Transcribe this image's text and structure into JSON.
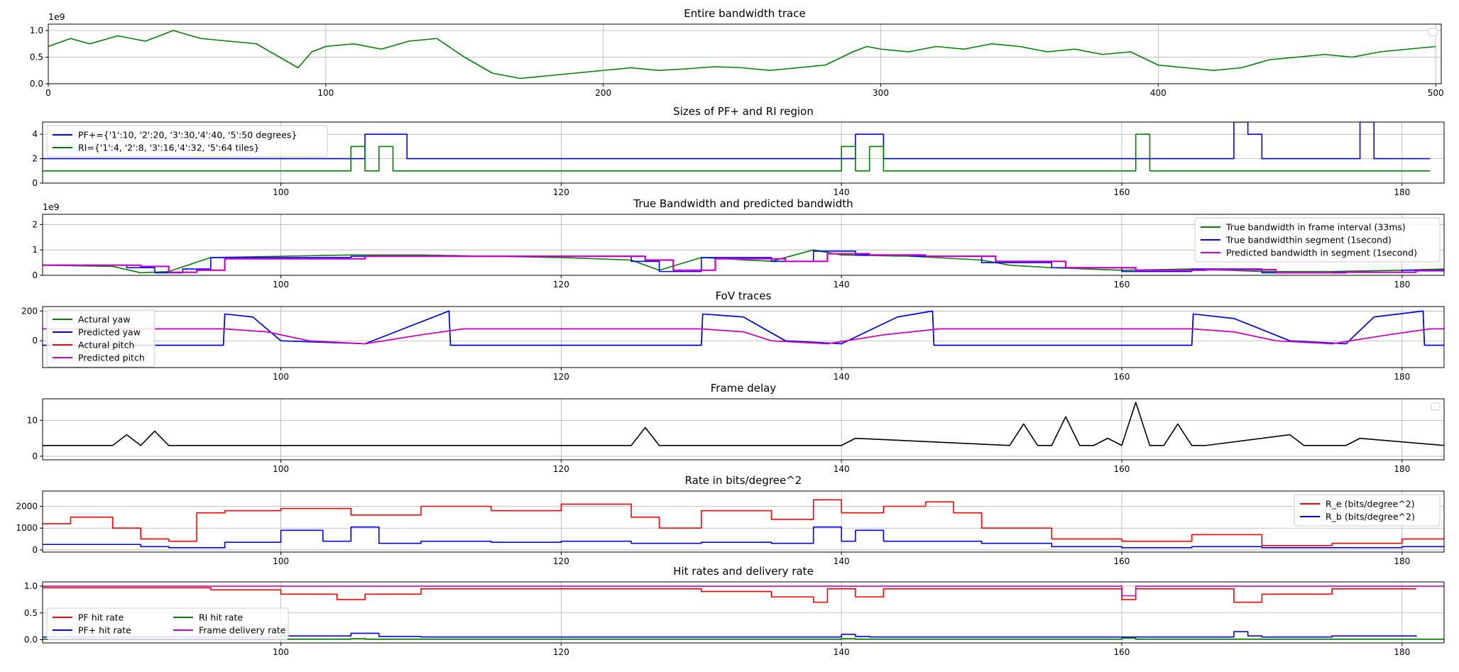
{
  "chart_data": [
    {
      "type": "line",
      "title": "Entire bandwidth trace",
      "xlim": [
        0,
        502
      ],
      "ylim": [
        0,
        1.12
      ],
      "y_exponent": "1e9",
      "xticks": [
        0,
        100,
        200,
        300,
        400,
        500
      ],
      "yticks": [
        0.0,
        0.5,
        1.0
      ],
      "ytick_labels": [
        "0.0",
        "0.5",
        "1.0"
      ],
      "grid": true,
      "legend": "top-right (empty)",
      "series": [
        {
          "color": "#008000",
          "x": [
            0,
            8,
            15,
            25,
            35,
            45,
            55,
            65,
            75,
            85,
            90,
            95,
            100,
            110,
            120,
            130,
            140,
            150,
            160,
            170,
            180,
            190,
            200,
            210,
            220,
            230,
            240,
            250,
            260,
            270,
            280,
            290,
            295,
            300,
            310,
            320,
            330,
            340,
            350,
            360,
            370,
            380,
            390,
            400,
            410,
            420,
            430,
            440,
            450,
            460,
            470,
            480,
            490,
            500
          ],
          "y": [
            0.7,
            0.85,
            0.75,
            0.9,
            0.8,
            1.0,
            0.85,
            0.8,
            0.75,
            0.45,
            0.3,
            0.6,
            0.7,
            0.75,
            0.65,
            0.8,
            0.85,
            0.5,
            0.2,
            0.1,
            0.15,
            0.2,
            0.25,
            0.3,
            0.25,
            0.28,
            0.32,
            0.3,
            0.25,
            0.3,
            0.35,
            0.6,
            0.7,
            0.65,
            0.6,
            0.7,
            0.65,
            0.75,
            0.7,
            0.6,
            0.65,
            0.55,
            0.6,
            0.35,
            0.3,
            0.25,
            0.3,
            0.45,
            0.5,
            0.55,
            0.5,
            0.6,
            0.65,
            0.7
          ]
        }
      ]
    },
    {
      "type": "line",
      "title": "Sizes of PF+ and RI region",
      "xlim": [
        83,
        183
      ],
      "ylim": [
        0,
        5
      ],
      "xticks": [
        100,
        120,
        140,
        160,
        180
      ],
      "yticks": [
        0,
        2,
        4
      ],
      "ytick_labels": [
        "0",
        "2",
        "4"
      ],
      "grid": true,
      "legend": "upper-left",
      "series": [
        {
          "name": "PF+={'1':10, '2':20, '3':30,'4':40, '5':50 degrees}",
          "color": "#0000ff",
          "step": true,
          "x": [
            83,
            106,
            109,
            141,
            143,
            168,
            169,
            170,
            177,
            178,
            182
          ],
          "y": [
            2,
            4,
            2,
            4,
            2,
            5,
            4,
            2,
            5,
            2,
            2
          ]
        },
        {
          "name": "RI={'1':4, '2':8, '3':16,'4':32, '5':64 tiles}",
          "color": "#008000",
          "step": true,
          "x": [
            83,
            105,
            106,
            107,
            108,
            140,
            141,
            142,
            143,
            161,
            162,
            182
          ],
          "y": [
            1,
            3,
            1,
            3,
            1,
            3,
            1,
            3,
            1,
            4,
            1,
            1
          ]
        }
      ]
    },
    {
      "type": "line",
      "title": "True Bandwidth and predicted bandwidth",
      "xlim": [
        83,
        183
      ],
      "ylim": [
        0,
        2.4
      ],
      "y_exponent": "1e9",
      "xticks": [
        100,
        120,
        140,
        160,
        180
      ],
      "yticks": [
        0,
        1,
        2
      ],
      "ytick_labels": [
        "0",
        "1",
        "2"
      ],
      "grid": true,
      "legend": "upper-right",
      "series": [
        {
          "name": "True bandwidth in frame interval (33ms)",
          "color": "#008000",
          "x": [
            83,
            88,
            90,
            92,
            95,
            100,
            105,
            110,
            115,
            120,
            125,
            127,
            130,
            135,
            138,
            140,
            145,
            150,
            152,
            155,
            160,
            165,
            170,
            175,
            180,
            183
          ],
          "y": [
            0.4,
            0.35,
            0.1,
            0.15,
            0.7,
            0.75,
            0.8,
            0.8,
            0.75,
            0.7,
            0.6,
            0.2,
            0.7,
            0.55,
            1.0,
            0.8,
            0.75,
            0.6,
            0.4,
            0.3,
            0.2,
            0.25,
            0.15,
            0.15,
            0.2,
            0.25
          ]
        },
        {
          "name": "True bandwidthin segment (1second)",
          "color": "#0000ff",
          "step": true,
          "x": [
            83,
            89,
            91,
            93,
            95,
            105,
            115,
            125,
            127,
            130,
            135,
            138,
            141,
            145,
            150,
            155,
            160,
            165,
            170,
            175,
            180,
            183
          ],
          "y": [
            0.4,
            0.3,
            0.1,
            0.25,
            0.7,
            0.75,
            0.75,
            0.55,
            0.15,
            0.7,
            0.55,
            0.95,
            0.8,
            0.75,
            0.5,
            0.3,
            0.15,
            0.25,
            0.1,
            0.12,
            0.2,
            0.2
          ]
        },
        {
          "name": "Predicted bandwidth in segment (1second)",
          "color": "#cc00cc",
          "step": true,
          "x": [
            83,
            90,
            92,
            94,
            96,
            106,
            116,
            126,
            128,
            131,
            136,
            139,
            142,
            146,
            151,
            156,
            161,
            166,
            171,
            176,
            181,
            183
          ],
          "y": [
            0.4,
            0.35,
            0.12,
            0.2,
            0.65,
            0.75,
            0.75,
            0.6,
            0.2,
            0.65,
            0.55,
            0.85,
            0.8,
            0.75,
            0.55,
            0.3,
            0.2,
            0.22,
            0.1,
            0.12,
            0.18,
            0.2
          ]
        }
      ]
    },
    {
      "type": "line",
      "title": "FoV traces",
      "xlim": [
        83,
        183
      ],
      "ylim": [
        -180,
        230
      ],
      "xticks": [
        100,
        120,
        140,
        160,
        180
      ],
      "yticks": [
        0,
        200
      ],
      "ytick_labels": [
        "0",
        "200"
      ],
      "grid": true,
      "legend": "upper-left",
      "series": [
        {
          "name": "Actural yaw",
          "color": "#008000",
          "x": [
            83,
            95.9,
            96,
            98,
            100,
            106,
            112,
            112.1,
            130,
            130.1,
            133,
            136,
            140,
            144,
            146.5,
            146.6,
            165,
            165.1,
            168,
            172,
            176,
            178,
            181.5,
            181.6,
            183
          ],
          "y": [
            -30,
            -30,
            180,
            160,
            0,
            -20,
            200,
            -30,
            -30,
            180,
            160,
            0,
            -20,
            160,
            200,
            -30,
            -30,
            180,
            150,
            0,
            -20,
            160,
            200,
            -30,
            -30
          ]
        },
        {
          "name": "Predicted yaw",
          "color": "#0000ff",
          "x": [
            83,
            95.9,
            96,
            98,
            100,
            106,
            112,
            112.1,
            130,
            130.1,
            133,
            136,
            140,
            144,
            146.5,
            146.6,
            165,
            165.1,
            168,
            172,
            176,
            178,
            181.5,
            181.6,
            183
          ],
          "y": [
            -30,
            -30,
            180,
            160,
            0,
            -20,
            200,
            -30,
            -30,
            180,
            160,
            0,
            -20,
            160,
            200,
            -30,
            -30,
            180,
            150,
            0,
            -20,
            160,
            200,
            -30,
            -30
          ]
        },
        {
          "name": "Actural pitch",
          "color": "#ff0000",
          "x": [
            83,
            96,
            99,
            102,
            106,
            110,
            113,
            130,
            133,
            135,
            139,
            143,
            147,
            165,
            168,
            171,
            175,
            179,
            182,
            183
          ],
          "y": [
            80,
            80,
            60,
            0,
            -20,
            40,
            80,
            80,
            60,
            0,
            -20,
            40,
            80,
            80,
            60,
            0,
            -20,
            40,
            80,
            80
          ]
        },
        {
          "name": "Predicted pitch",
          "color": "#cc00cc",
          "x": [
            83,
            96,
            99,
            102,
            106,
            110,
            113,
            130,
            133,
            135,
            139,
            143,
            147,
            165,
            168,
            171,
            175,
            179,
            182,
            183
          ],
          "y": [
            80,
            80,
            60,
            0,
            -20,
            40,
            80,
            80,
            60,
            0,
            -20,
            40,
            80,
            80,
            60,
            0,
            -20,
            40,
            80,
            80
          ]
        }
      ]
    },
    {
      "type": "line",
      "title": "Frame delay",
      "xlim": [
        83,
        183
      ],
      "ylim": [
        -1,
        16
      ],
      "xticks": [
        100,
        120,
        140,
        160,
        180
      ],
      "yticks": [
        0,
        10
      ],
      "ytick_labels": [
        "0",
        "10"
      ],
      "grid": true,
      "legend": "top-right (empty)",
      "series": [
        {
          "color": "#000000",
          "x": [
            83,
            88,
            89,
            90,
            91,
            92,
            93,
            125,
            126,
            127,
            128,
            140,
            141,
            152,
            153,
            154,
            155,
            156,
            157,
            158,
            159,
            160,
            161,
            162,
            163,
            164,
            165,
            166,
            172,
            173,
            176,
            177,
            183
          ],
          "y": [
            3,
            3,
            6,
            3,
            7,
            3,
            3,
            3,
            8,
            3,
            3,
            3,
            5,
            3,
            9,
            3,
            3,
            11,
            3,
            3,
            5,
            3,
            15,
            3,
            3,
            9,
            3,
            3,
            6,
            3,
            3,
            5,
            3
          ]
        }
      ]
    },
    {
      "type": "line",
      "title": "Rate in bits/degree^2",
      "xlim": [
        83,
        183
      ],
      "ylim": [
        -100,
        2700
      ],
      "xticks": [
        100,
        120,
        140,
        160,
        180
      ],
      "yticks": [
        0,
        1000,
        2000
      ],
      "ytick_labels": [
        "0",
        "1000",
        "2000"
      ],
      "grid": true,
      "legend": "upper-right",
      "series": [
        {
          "name": "R_e (bits/degree^2)",
          "color": "#ff0000",
          "step": true,
          "x": [
            83,
            85,
            88,
            90,
            92,
            94,
            96,
            100,
            105,
            110,
            115,
            120,
            125,
            127,
            130,
            135,
            138,
            140,
            143,
            146,
            148,
            150,
            155,
            160,
            165,
            170,
            175,
            180,
            183
          ],
          "y": [
            1200,
            1500,
            1000,
            500,
            400,
            1700,
            1800,
            1900,
            1600,
            2000,
            1800,
            2100,
            1500,
            1000,
            1800,
            1400,
            2300,
            1700,
            2000,
            2200,
            1700,
            1000,
            500,
            400,
            700,
            200,
            300,
            500,
            600
          ]
        },
        {
          "name": "R_b (bits/degree^2)",
          "color": "#0000ff",
          "step": true,
          "x": [
            83,
            88,
            90,
            92,
            96,
            100,
            103,
            105,
            107,
            110,
            115,
            120,
            125,
            130,
            135,
            138,
            140,
            141,
            143,
            146,
            150,
            155,
            160,
            165,
            170,
            175,
            180,
            183
          ],
          "y": [
            250,
            250,
            150,
            100,
            350,
            900,
            400,
            1050,
            300,
            400,
            350,
            400,
            300,
            350,
            300,
            1050,
            400,
            900,
            400,
            400,
            300,
            150,
            100,
            150,
            100,
            100,
            150,
            200
          ]
        }
      ]
    },
    {
      "type": "line",
      "title": "Hit rates and delivery rate",
      "xlim": [
        83,
        183
      ],
      "ylim": [
        -0.06,
        1.08
      ],
      "xticks": [
        100,
        120,
        140,
        160,
        180
      ],
      "yticks": [
        0.0,
        0.5,
        1.0
      ],
      "ytick_labels": [
        "0.0",
        "0.5",
        "1.0"
      ],
      "grid": true,
      "legend": "lower-left, 2 columns",
      "series": [
        {
          "name": "PF hit rate",
          "color": "#ff0000",
          "step": true,
          "x": [
            83,
            95,
            100,
            104,
            106,
            110,
            120,
            130,
            135,
            138,
            139,
            141,
            143,
            150,
            160,
            161,
            165,
            168,
            170,
            175,
            181
          ],
          "y": [
            0.97,
            0.93,
            0.85,
            0.75,
            0.85,
            0.95,
            0.95,
            0.9,
            0.8,
            0.7,
            0.95,
            0.8,
            0.95,
            0.95,
            0.75,
            0.95,
            0.95,
            0.7,
            0.85,
            0.95,
            0.95
          ]
        },
        {
          "name": "PF+ hit rate",
          "color": "#0000ff",
          "step": true,
          "x": [
            83,
            100,
            105,
            107,
            110,
            120,
            140,
            141,
            142,
            150,
            160,
            168,
            169,
            170,
            175,
            181
          ],
          "y": [
            0.05,
            0.07,
            0.12,
            0.06,
            0.05,
            0.05,
            0.1,
            0.06,
            0.05,
            0.05,
            0.05,
            0.15,
            0.07,
            0.05,
            0.07,
            0.05
          ]
        },
        {
          "name": "RI hit rate",
          "color": "#008000",
          "step": true,
          "x": [
            83,
            105,
            106,
            140,
            141,
            160,
            161,
            183
          ],
          "y": [
            0.01,
            0.02,
            0.01,
            0.02,
            0.01,
            0.03,
            0.01,
            0.01
          ]
        },
        {
          "name": "Frame delivery rate",
          "color": "#cc00cc",
          "step": true,
          "x": [
            83,
            160,
            161,
            183
          ],
          "y": [
            1.0,
            0.82,
            1.0,
            1.0
          ]
        }
      ]
    }
  ]
}
